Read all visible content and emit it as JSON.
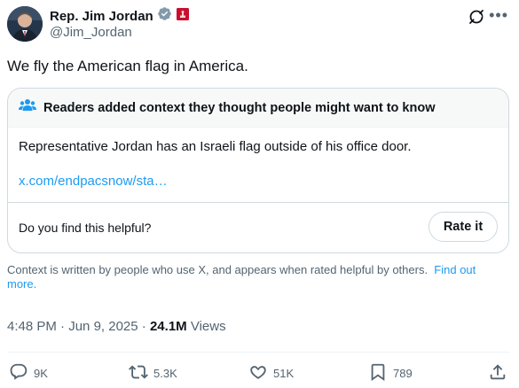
{
  "author": {
    "name": "Rep. Jim Jordan",
    "handle": "@Jim_Jordan"
  },
  "tweet": {
    "text": "We fly the American flag in America."
  },
  "community_note": {
    "header": "Readers added context they thought people might want to know",
    "body": "Representative Jordan has an Israeli flag outside of his office door.",
    "link": "x.com/endpacsnow/sta…",
    "helpful_question": "Do you find this helpful?",
    "rate_button": "Rate it"
  },
  "context_footer": {
    "text": "Context is written by people who use X, and appears when rated helpful by others.",
    "link": "Find out more."
  },
  "meta": {
    "time": "4:48 PM",
    "date": "Jun 9, 2025",
    "views_count": "24.1M",
    "views_label": "Views"
  },
  "actions": {
    "replies": "9K",
    "reposts": "5.3K",
    "likes": "51K",
    "bookmarks": "789"
  },
  "colors": {
    "accent": "#1d9bf0",
    "secondary_text": "#536471",
    "border": "#cfd9de"
  }
}
